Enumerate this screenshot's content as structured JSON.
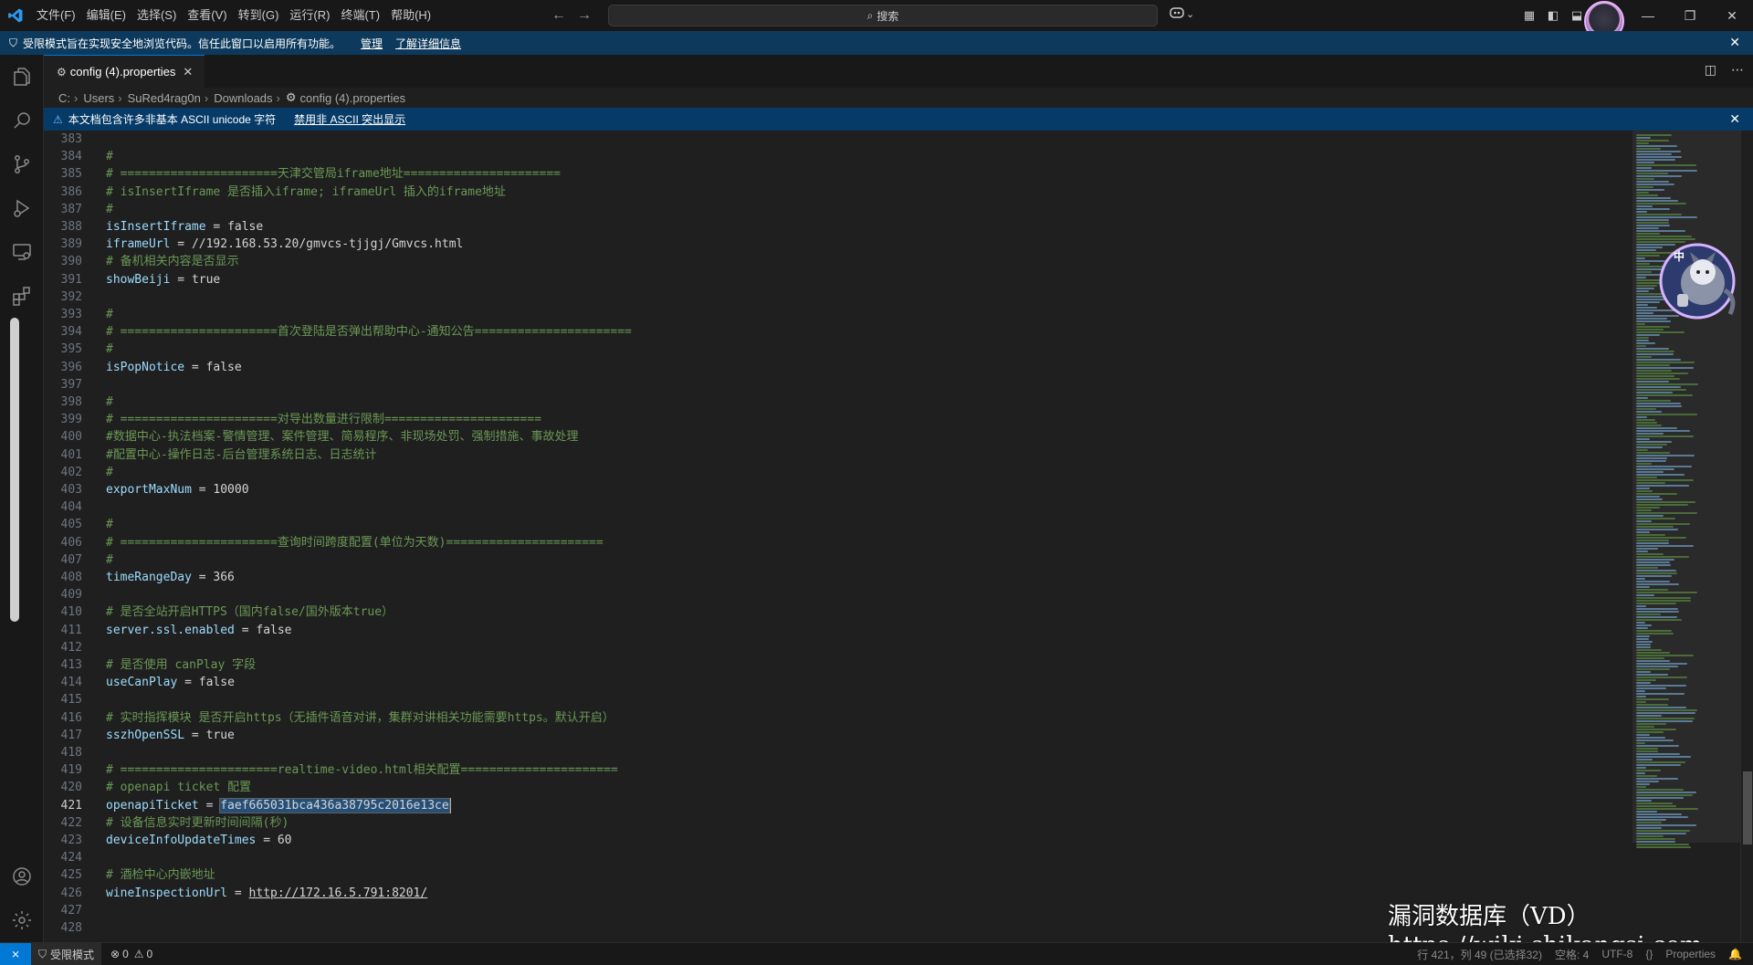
{
  "titlebar": {
    "menu": [
      "文件(F)",
      "编辑(E)",
      "选择(S)",
      "查看(V)",
      "转到(G)",
      "运行(R)",
      "终端(T)",
      "帮助(H)"
    ],
    "search_placeholder": "搜索"
  },
  "banner": {
    "text": "受限模式旨在实现安全地浏览代码。信任此窗口以启用所有功能。",
    "manage": "管理",
    "learn_more": "了解详细信息"
  },
  "tab": {
    "label": "config (4).properties"
  },
  "breadcrumb": {
    "drive": "C:",
    "users": "Users",
    "user": "SuRed4rag0n",
    "folder": "Downloads",
    "file": "config (4).properties"
  },
  "notice": {
    "text": "本文档包含许多非基本 ASCII unicode 字符",
    "action": "禁用非 ASCII 突出显示"
  },
  "editor": {
    "current_line": "421",
    "lines": [
      {
        "n": "383",
        "t": "blank"
      },
      {
        "n": "384",
        "t": "comment",
        "text": "#"
      },
      {
        "n": "385",
        "t": "comment",
        "text": "# ======================天津交管局iframe地址======================"
      },
      {
        "n": "386",
        "t": "comment",
        "text": "# isInsertIframe 是否插入iframe; iframeUrl 插入的iframe地址"
      },
      {
        "n": "387",
        "t": "comment",
        "text": "#"
      },
      {
        "n": "388",
        "t": "prop",
        "key": "isInsertIframe",
        "value": "false"
      },
      {
        "n": "389",
        "t": "prop",
        "key": "iframeUrl",
        "value": "//192.168.53.20/gmvcs-tjjgj/Gmvcs.html"
      },
      {
        "n": "390",
        "t": "comment",
        "text": "# 备机相关内容是否显示"
      },
      {
        "n": "391",
        "t": "prop",
        "key": "showBeiji",
        "value": "true"
      },
      {
        "n": "392",
        "t": "blank"
      },
      {
        "n": "393",
        "t": "comment",
        "text": "#"
      },
      {
        "n": "394",
        "t": "comment",
        "text": "# ======================首次登陆是否弹出帮助中心-通知公告======================"
      },
      {
        "n": "395",
        "t": "comment",
        "text": "#"
      },
      {
        "n": "396",
        "t": "prop",
        "key": "isPopNotice",
        "value": "false"
      },
      {
        "n": "397",
        "t": "blank"
      },
      {
        "n": "398",
        "t": "comment",
        "text": "#"
      },
      {
        "n": "399",
        "t": "comment",
        "text": "# ======================对导出数量进行限制======================"
      },
      {
        "n": "400",
        "t": "comment",
        "text": "#数据中心-执法档案-警情管理、案件管理、简易程序、非现场处罚、强制措施、事故处理"
      },
      {
        "n": "401",
        "t": "comment",
        "text": "#配置中心-操作日志-后台管理系统日志、日志统计"
      },
      {
        "n": "402",
        "t": "comment",
        "text": "#"
      },
      {
        "n": "403",
        "t": "prop",
        "key": "exportMaxNum",
        "value": "10000"
      },
      {
        "n": "404",
        "t": "blank"
      },
      {
        "n": "405",
        "t": "comment",
        "text": "#"
      },
      {
        "n": "406",
        "t": "comment",
        "text": "# ======================查询时间跨度配置(单位为天数)======================"
      },
      {
        "n": "407",
        "t": "comment",
        "text": "#"
      },
      {
        "n": "408",
        "t": "prop",
        "key": "timeRangeDay",
        "value": "366"
      },
      {
        "n": "409",
        "t": "blank"
      },
      {
        "n": "410",
        "t": "comment",
        "text": "# 是否全站开启HTTPS（国内false/国外版本true）"
      },
      {
        "n": "411",
        "t": "prop",
        "key": "server.ssl.enabled",
        "value": "false"
      },
      {
        "n": "412",
        "t": "blank"
      },
      {
        "n": "413",
        "t": "comment",
        "text": "# 是否使用 canPlay 字段"
      },
      {
        "n": "414",
        "t": "prop",
        "key": "useCanPlay",
        "value": "false"
      },
      {
        "n": "415",
        "t": "blank"
      },
      {
        "n": "416",
        "t": "comment",
        "text": "# 实时指挥模块 是否开启https（无插件语音对讲，集群对讲相关功能需要https。默认开启）"
      },
      {
        "n": "417",
        "t": "prop",
        "key": "sszhOpenSSL",
        "value": "true"
      },
      {
        "n": "418",
        "t": "blank"
      },
      {
        "n": "419",
        "t": "comment",
        "text": "# ======================realtime-video.html相关配置======================"
      },
      {
        "n": "420",
        "t": "comment",
        "text": "# openapi ticket 配置"
      },
      {
        "n": "421",
        "t": "selprop",
        "key": "openapiTicket",
        "value": "faef665031bca436a38795c2016e13ce"
      },
      {
        "n": "422",
        "t": "comment",
        "text": "# 设备信息实时更新时间间隔(秒)"
      },
      {
        "n": "423",
        "t": "prop",
        "key": "deviceInfoUpdateTimes",
        "value": "60"
      },
      {
        "n": "424",
        "t": "blank"
      },
      {
        "n": "425",
        "t": "comment",
        "text": "# 酒检中心内嵌地址"
      },
      {
        "n": "426",
        "t": "urlprop",
        "key": "wineInspectionUrl",
        "value": "http://172.16.5.791:8201/"
      },
      {
        "n": "427",
        "t": "blank"
      },
      {
        "n": "428",
        "t": "blank"
      }
    ]
  },
  "statusbar": {
    "restricted": "受限模式",
    "errors": "0",
    "warnings": "0",
    "position": "行 421，列 49 (已选择32)",
    "spaces": "空格: 4",
    "encoding": "UTF-8",
    "language": "Properties"
  },
  "watermark": {
    "line1": "漏洞数据库（VD）",
    "line2": "https://wiki.shikangsi.com"
  },
  "pet": {
    "badge": "中"
  },
  "colors": {
    "accent": "#0078d4",
    "comment": "#6a9955",
    "key": "#9cdcfe",
    "banner": "#0d3a5c"
  }
}
